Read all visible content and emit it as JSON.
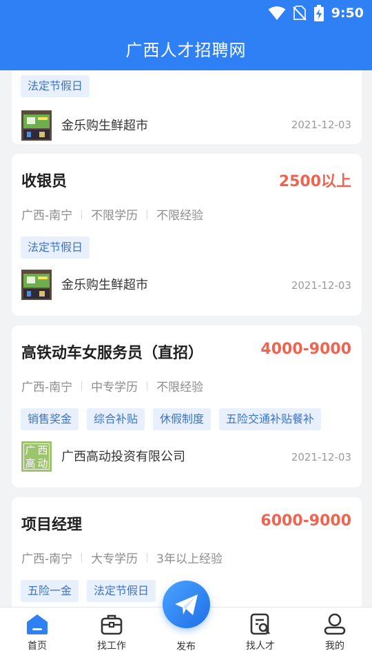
{
  "status_bar": {
    "time": "9:50"
  },
  "header": {
    "title": "广西人才招聘网"
  },
  "jobs": [
    {
      "tags": [
        "法定节假日"
      ],
      "company": "金乐购生鲜超市",
      "date": "2021-12-03"
    },
    {
      "title": "收银员",
      "salary": "2500以上",
      "location": "广西-南宁",
      "education": "不限学历",
      "experience": "不限经验",
      "tags": [
        "法定节假日"
      ],
      "company": "金乐购生鲜超市",
      "date": "2021-12-03"
    },
    {
      "title": "高铁动车女服务员（直招）",
      "salary": "4000-9000",
      "location": "广西-南宁",
      "education": "中专学历",
      "experience": "不限经验",
      "tags": [
        "销售奖金",
        "综合补贴",
        "休假制度",
        "五险交通补贴餐补"
      ],
      "company": "广西高动投资有限公司",
      "logo_text": [
        "广",
        "西",
        "高",
        "动"
      ],
      "date": "2021-12-03"
    },
    {
      "title": "项目经理",
      "salary": "6000-9000",
      "location": "广西-南宁",
      "education": "大专学历",
      "experience": "3年以上经验",
      "tags": [
        "五险一金",
        "法定节假日"
      ]
    }
  ],
  "tabbar": {
    "items": [
      {
        "label": "首页",
        "icon": "home-icon",
        "active": true
      },
      {
        "label": "找工作",
        "icon": "briefcase-icon"
      },
      {
        "label": "发布",
        "icon": "paper-plane-icon"
      },
      {
        "label": "找人才",
        "icon": "search-document-icon"
      },
      {
        "label": "我的",
        "icon": "user-icon"
      }
    ]
  },
  "colors": {
    "primary": "#2f80f5",
    "salary": "#f0644f",
    "tag_bg": "#e8f0fd",
    "tag_text": "#3b73c9"
  }
}
